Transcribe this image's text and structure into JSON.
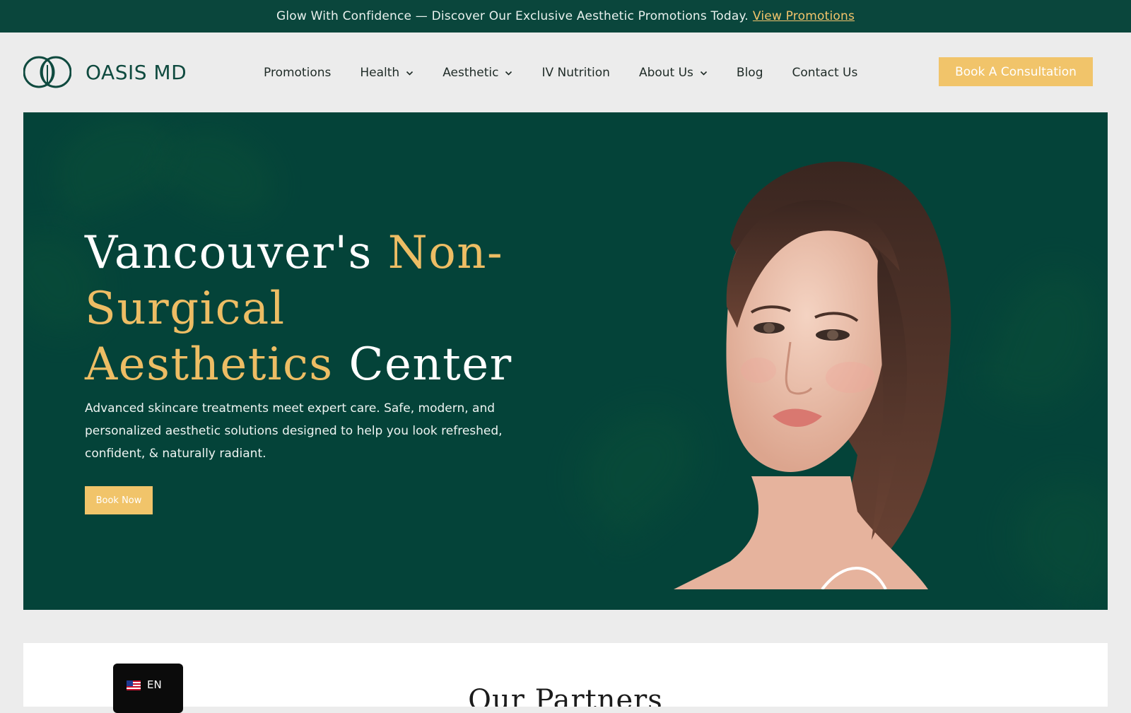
{
  "announcement": {
    "text": "Glow With Confidence — Discover Our Exclusive Aesthetic Promotions Today.",
    "link": "View Promotions"
  },
  "brand": {
    "name": "OASIS MD",
    "logo_icon": "leaf-circle-logo-icon"
  },
  "nav": {
    "items": [
      {
        "label": "Promotions",
        "dropdown": false
      },
      {
        "label": "Health",
        "dropdown": true
      },
      {
        "label": "Aesthetic",
        "dropdown": true
      },
      {
        "label": "IV Nutrition",
        "dropdown": false
      },
      {
        "label": "About Us",
        "dropdown": true
      },
      {
        "label": "Blog",
        "dropdown": false
      },
      {
        "label": "Contact Us",
        "dropdown": false
      }
    ],
    "cta_label": "Book A Consultation"
  },
  "hero": {
    "title_part1": "Vancouver's ",
    "title_part2": "Non-Surgical",
    "title_part3": "Aesthetics",
    "title_part4": " Center",
    "description": "Advanced skincare treatments meet expert care. Safe, modern, and personalized aesthetic solutions designed to help you look refreshed, confident, & naturally radiant.",
    "button_label": "Book Now"
  },
  "partners": {
    "title": "Our Partners"
  },
  "language": {
    "label": "EN",
    "flag_icon": "us-flag-icon"
  },
  "colors": {
    "brand_green": "#0a463c",
    "hero_green": "#044339",
    "accent_gold": "#f1c46a"
  }
}
